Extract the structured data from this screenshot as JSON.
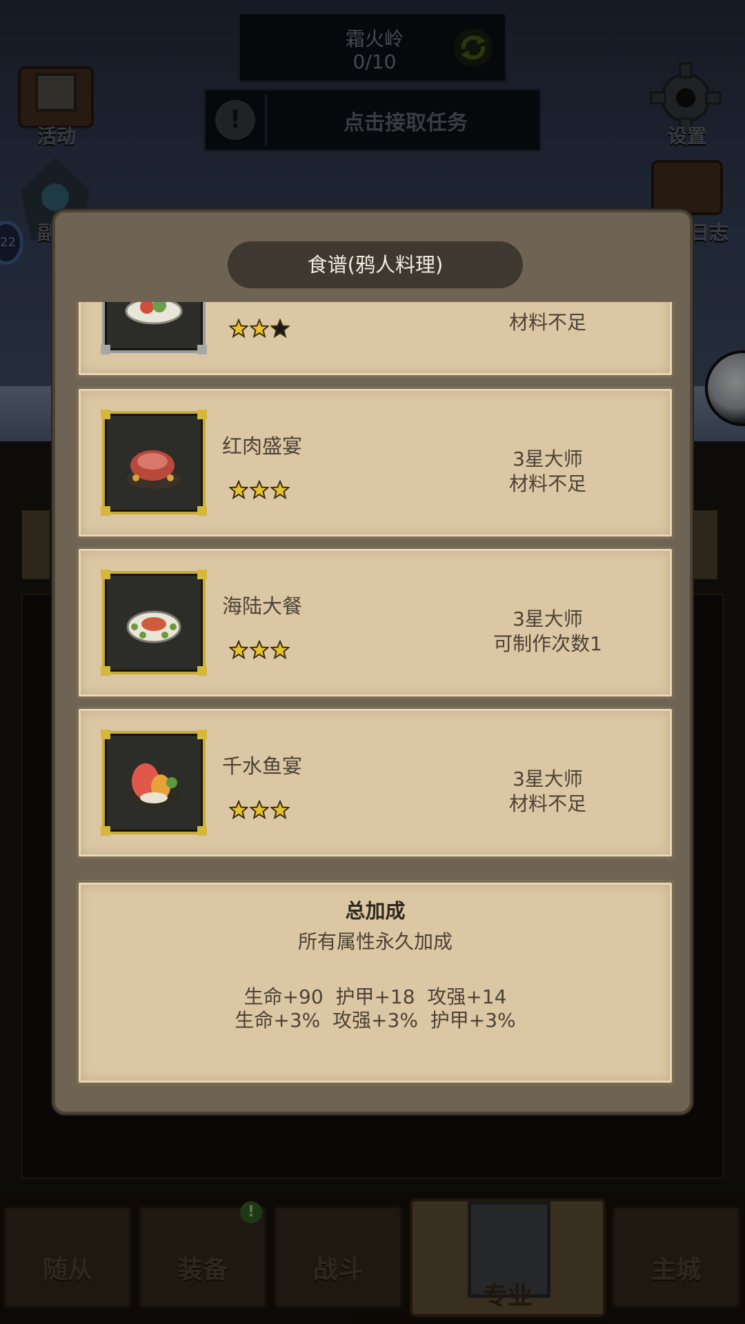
{
  "hud": {
    "zone_name": "霜火岭",
    "zone_progress": "0/10",
    "quest_text": "点击接取任务",
    "activity_label": "活动",
    "settings_label": "设置",
    "dungeon_label": "副",
    "journal_label": "日志",
    "chat_count": "22"
  },
  "modal": {
    "title": "食谱(鸦人料理)",
    "recipes": [
      {
        "name": "",
        "stars_filled": 2,
        "stars_total": 3,
        "rank": "",
        "status": "材料不足",
        "locked": true
      },
      {
        "name": "红肉盛宴",
        "stars_filled": 3,
        "stars_total": 3,
        "rank": "3星大师",
        "status": "材料不足",
        "locked": false
      },
      {
        "name": "海陆大餐",
        "stars_filled": 3,
        "stars_total": 3,
        "rank": "3星大师",
        "status": "可制作次数1",
        "locked": false
      },
      {
        "name": "千水鱼宴",
        "stars_filled": 3,
        "stars_total": 3,
        "rank": "3星大师",
        "status": "材料不足",
        "locked": false
      }
    ],
    "summary": {
      "title": "总加成",
      "subtitle": "所有属性永久加成",
      "line1": "生命+90  护甲+18  攻强+14",
      "line2": "生命+3%  攻强+3%  护甲+3%"
    }
  },
  "nav": {
    "tabs": [
      {
        "label": "随从",
        "active": false
      },
      {
        "label": "装备",
        "active": false,
        "badge": "!"
      },
      {
        "label": "战斗",
        "active": false
      },
      {
        "label": "专业",
        "active": true
      },
      {
        "label": "主城",
        "active": false
      }
    ]
  },
  "colors": {
    "parchment": "#dcc7a4",
    "gold_frame": "#c9ad33",
    "star_gold": "#e8c12c",
    "modal_frame": "#6f6453",
    "title_pill": "#3f3830"
  }
}
